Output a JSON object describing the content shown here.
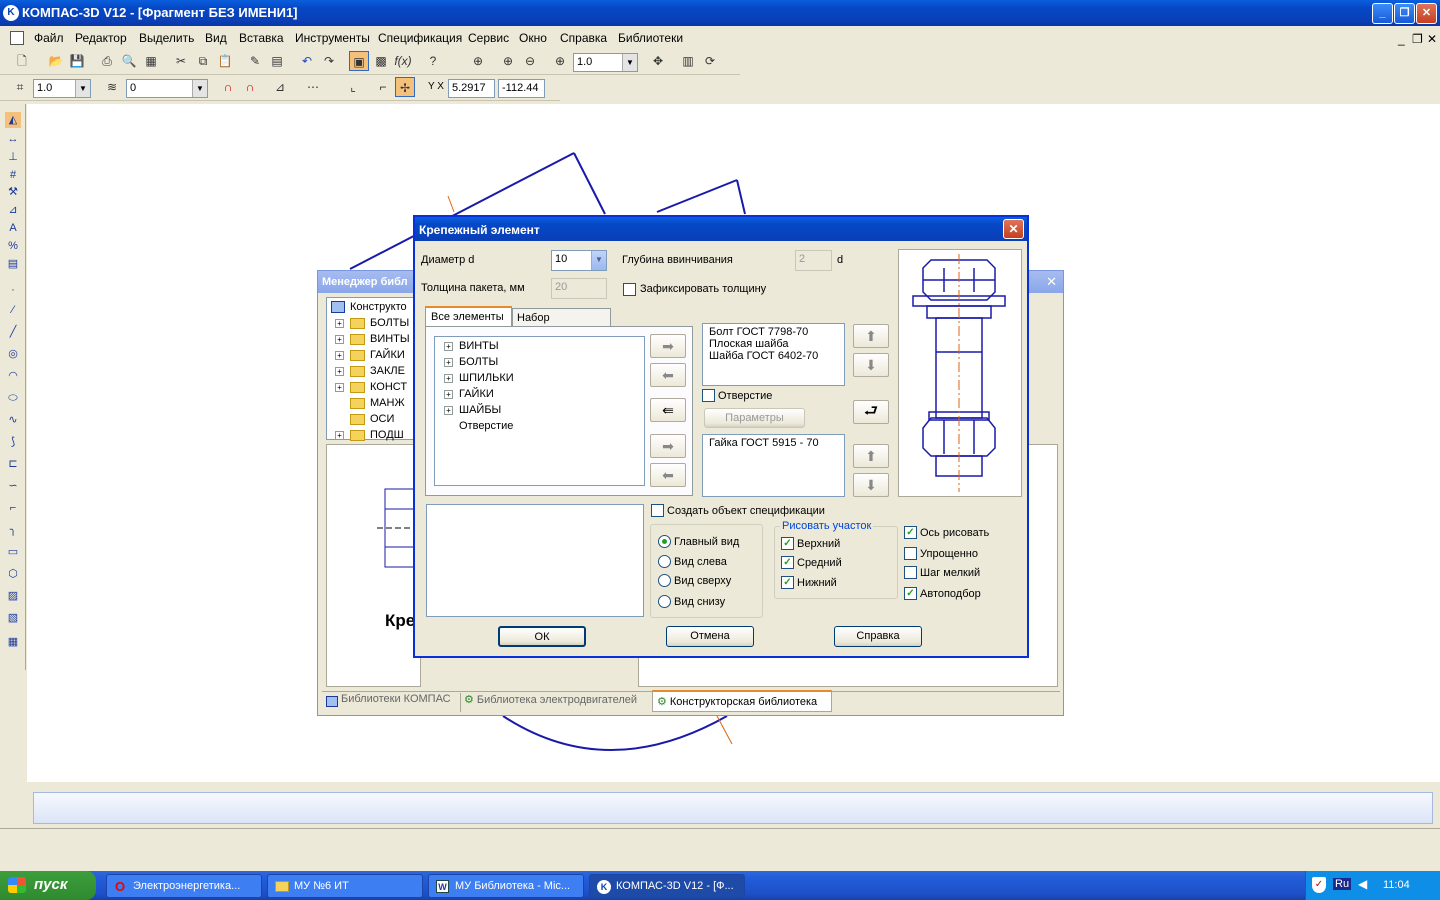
{
  "app": {
    "title": "КОМПАС-3D V12 - [Фрагмент БЕЗ ИМЕНИ1]"
  },
  "menu": [
    "Файл",
    "Редактор",
    "Выделить",
    "Вид",
    "Вставка",
    "Инструменты",
    "Спецификация",
    "Сервис",
    "Окно",
    "Справка",
    "Библиотеки"
  ],
  "toolbar": {
    "zoom_value": "1.0",
    "scale_value": "1.0",
    "layer_value": "0",
    "coord_x": "5.2917",
    "coord_y": "-112.44",
    "coord_label": "Y X"
  },
  "lib_manager": {
    "title": "Менеджер библ",
    "root": "Конструкто",
    "items": [
      "БОЛТЫ",
      "ВИНТЫ",
      "ГАЙКИ",
      "ЗАКЛЕ",
      "КОНСТ",
      "МАНЖ",
      "ОСИ",
      "ПОДШ"
    ],
    "preview_caption": "Кре",
    "tabs": [
      "Библиотеки КОМПАС",
      "Библиотека электродвигателей",
      "Конструкторская библиотека"
    ]
  },
  "dialog": {
    "title": "Крепежный элемент",
    "diameter_label": "Диаметр d",
    "diameter_value": "10",
    "depth_label": "Глубина ввинчивания",
    "depth_value": "2",
    "depth_unit": "d",
    "thickness_label": "Толщина пакета, мм",
    "thickness_value": "20",
    "fix_thickness_label": "Зафиксировать толщину",
    "tab_all": "Все элементы",
    "tab_set": "Набор элементов",
    "tree": [
      "ВИНТЫ",
      "БОЛТЫ",
      "ШПИЛЬКИ",
      "ГАЙКИ",
      "ШАЙБЫ",
      "Отверстие"
    ],
    "top_list": [
      "Болт ГОСТ 7798-70",
      "Плоская шайба",
      "Шайба ГОСТ 6402-70"
    ],
    "hole_label": "Отверстие",
    "params_button": "Параметры",
    "bottom_list": [
      "Гайка ГОСТ 5915 - 70"
    ],
    "spec_label": "Создать объект спецификации",
    "views": [
      "Главный вид",
      "Вид слева",
      "Вид сверху",
      "Вид снизу"
    ],
    "draw_section_title": "Рисовать участок",
    "sections": [
      "Верхний",
      "Средний",
      "Нижний"
    ],
    "options": [
      "Ось рисовать",
      "Упрощенно",
      "Шаг мелкий",
      "Автоподбор"
    ],
    "ok": "ОК",
    "cancel": "Отмена",
    "help": "Справка"
  },
  "taskbar": {
    "start": "пуск",
    "tasks": [
      "Электроэнергетика...",
      "МУ №6 ИТ",
      "МУ Библиотека - Mic...",
      "КОМПАС-3D V12 - [Ф..."
    ],
    "lang": "RU",
    "lang2": "Ru",
    "time": "11:04"
  }
}
